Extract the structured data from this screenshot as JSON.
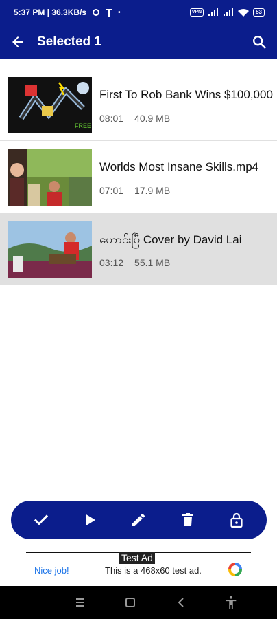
{
  "status_bar": {
    "time_speed": "5:37 PM | 36.3KB/s",
    "vpn": "VPN",
    "battery": "53"
  },
  "header": {
    "title": "Selected 1"
  },
  "videos": [
    {
      "title": "First To Rob Bank Wins $100,000",
      "duration": "08:01",
      "size": "40.9 MB",
      "selected": false
    },
    {
      "title": "Worlds Most Insane Skills.mp4",
      "duration": "07:01",
      "size": "17.9 MB",
      "selected": false
    },
    {
      "title": "ဟောင်းပြီ Cover by David Lai",
      "duration": "03:12",
      "size": "55.1 MB",
      "selected": true
    }
  ],
  "action_bar": {
    "icons": [
      "check-icon",
      "play-icon",
      "edit-icon",
      "delete-icon",
      "lock-icon"
    ]
  },
  "ad": {
    "label": "Test Ad",
    "nice": "Nice job!",
    "text": "This is a 468x60 test ad."
  },
  "colors": {
    "primary": "#0b1d8c",
    "selected_row": "#e0e0e0"
  }
}
